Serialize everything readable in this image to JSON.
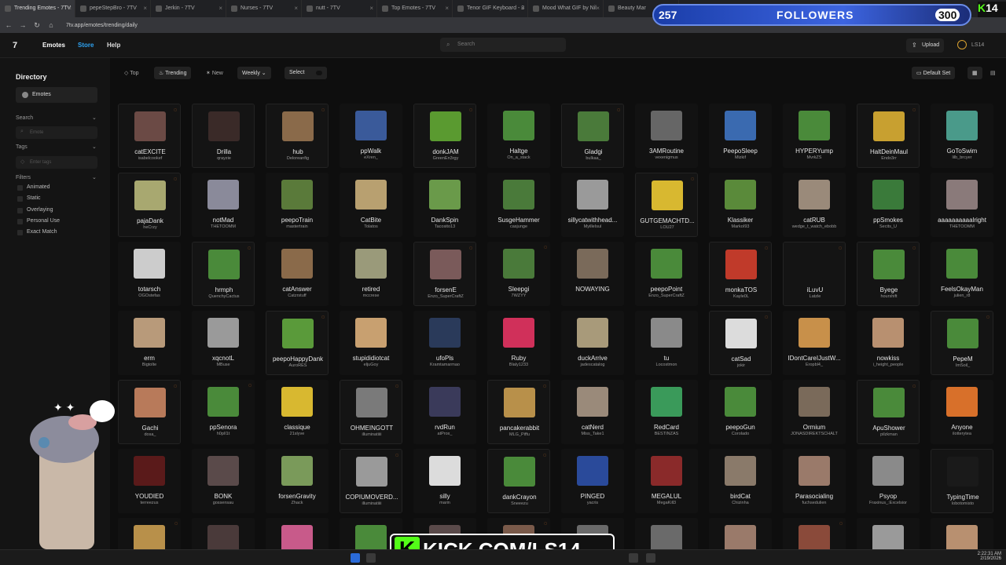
{
  "browser": {
    "tabs": [
      "Trending Emotes - 7TV",
      "pepeStepBro - 7TV",
      "Jerkin - 7TV",
      "Nurses - 7TV",
      "nutt - 7TV",
      "Top Emotes - 7TV",
      "Tenor GIF Keyboard - 3",
      "Mood What GIF by Nil",
      "Beauty Mar"
    ],
    "url": "7tv.app/emotes/trending/daily"
  },
  "app": {
    "nav": {
      "emotes": "Emotes",
      "store": "Store",
      "help": "Help"
    },
    "search_placeholder": "Search",
    "upload": "Upload",
    "user": "LS14"
  },
  "sidebar": {
    "title": "Directory",
    "emotes": "Emotes",
    "search_label": "Search",
    "emote_placeholder": "Emote",
    "tags_label": "Tags",
    "tags_placeholder": "Enter tags",
    "filters_label": "Filters",
    "filters": [
      "Animated",
      "Static",
      "Overlaying",
      "Personal Use",
      "Exact Match"
    ]
  },
  "toolbar": {
    "top": "Top",
    "trending": "Trending",
    "new": "New",
    "weekly": "Weekly",
    "select": "Select",
    "default_set": "Default Set"
  },
  "overlay": {
    "followers_current": "257",
    "followers_label": "FOLLOWERS",
    "followers_goal": "300",
    "kick_corner": "14",
    "kick_banner": "KICK.COM/LS14"
  },
  "clock": {
    "time": "2:22:31 AM",
    "date": "2/19/2026"
  },
  "emotes": [
    [
      {
        "n": "catEXCITE",
        "o": "isabelcookef",
        "c": "#6b4a45"
      },
      {
        "n": "Drilla",
        "o": "qrayzie",
        "c": "#3a2a28"
      },
      {
        "n": "hub",
        "o": "Deloreanfig",
        "c": "#8a6a4a"
      },
      {
        "n": "ppWalk",
        "o": "eXren_",
        "c": "#3a5a9a"
      },
      {
        "n": "donkJAM",
        "o": "GreenEn3rgy",
        "c": "#5a9a30"
      },
      {
        "n": "Haltge",
        "o": "On_a_stack",
        "c": "#4a8a3a"
      },
      {
        "n": "Gladgi",
        "o": "bulkaa_",
        "c": "#4a7a3a"
      },
      {
        "n": "3AMRoutine",
        "o": "vexenigmus",
        "c": "#666666"
      },
      {
        "n": "PeepoSleep",
        "o": "Mizkif",
        "c": "#3a6ab0"
      },
      {
        "n": "HYPERYump",
        "o": "MvrkZS",
        "c": "#4a8a3a"
      },
      {
        "n": "HaltDeinMaul",
        "o": "Endo3rr",
        "c": "#c8a030"
      },
      {
        "n": "GoToSwim",
        "o": "lilb_brcyer",
        "c": "#4a9a8a"
      }
    ],
    [
      {
        "n": "pajaDank",
        "o": "heCrzy",
        "c": "#a8a870"
      },
      {
        "n": "notMad",
        "o": "THETOOMM",
        "c": "#8a8a9a"
      },
      {
        "n": "peepoTrain",
        "o": "mastertrain",
        "c": "#5a7a3a"
      },
      {
        "n": "CatBite",
        "o": "Tolatos",
        "c": "#b8a070"
      },
      {
        "n": "DankSpin",
        "o": "Tacosito13",
        "c": "#6a9a4a"
      },
      {
        "n": "SusgeHammer",
        "o": "casjunge",
        "c": "#4a7a3a"
      },
      {
        "n": "sillycatwithhead...",
        "o": "MyilleIsul",
        "c": "#9a9a9a"
      },
      {
        "n": "GUTGEMACHTD...",
        "o": "LOU27",
        "c": "#d8b830"
      },
      {
        "n": "Klassiker",
        "o": "MarkoI93",
        "c": "#5a8a3a"
      },
      {
        "n": "catRUB",
        "o": "wedge_t_watch_ebobb",
        "c": "#9a8a7a"
      },
      {
        "n": "ppSmokes",
        "o": "Secits_U",
        "c": "#3a7a3a"
      },
      {
        "n": "aaaaaaaaaalright",
        "o": "THETOOMM",
        "c": "#8a7a7a"
      }
    ],
    [
      {
        "n": "totarsch",
        "o": "OGOstefas",
        "c": "#cccccc"
      },
      {
        "n": "hrmph",
        "o": "QuenchyCactus",
        "c": "#4a8a3a"
      },
      {
        "n": "catAnswer",
        "o": "Catzrstuff",
        "c": "#8a6a4a"
      },
      {
        "n": "retired",
        "o": "mccrese",
        "c": "#9a9a7a"
      },
      {
        "n": "forsenE",
        "o": "Enzo_SuperCraftZ",
        "c": "#7a5a5a"
      },
      {
        "n": "Sleepgi",
        "o": "7WZYY",
        "c": "#4a7a3a"
      },
      {
        "n": "NOWAYING",
        "o": "",
        "c": "#7a6a5a"
      },
      {
        "n": "peepoPoint",
        "o": "Enzo_SuperCraftZ",
        "c": "#4a8a3a"
      },
      {
        "n": "monkaTOS",
        "o": "Kayle0L",
        "c": "#c03a2a"
      },
      {
        "n": "iLuvU",
        "o": "Latzle",
        "c": "#141414"
      },
      {
        "n": "Byege",
        "o": "hourshift",
        "c": "#4a8a3a"
      },
      {
        "n": "FeelsOkayMan",
        "o": "julien_r8",
        "c": "#4a8a3a"
      }
    ],
    [
      {
        "n": "erm",
        "o": "Bigtolte",
        "c": "#b89a7a"
      },
      {
        "n": "xqcnotL",
        "o": "MBuse",
        "c": "#9a9a9a"
      },
      {
        "n": "peepoHappyDank",
        "o": "AuroRES",
        "c": "#5a9a3a"
      },
      {
        "n": "stupididiotcat",
        "o": "eljuGoy",
        "c": "#c8a070"
      },
      {
        "n": "ufoPls",
        "o": "Kramtamarmao",
        "c": "#2a3a5a"
      },
      {
        "n": "Ruby",
        "o": "Blaly1233",
        "c": "#d0305a"
      },
      {
        "n": "duckArrive",
        "o": "jadescatalog",
        "c": "#a89a7a"
      },
      {
        "n": "tu",
        "o": "Locostmon",
        "c": "#8a8a8a"
      },
      {
        "n": "catSad",
        "o": "jokir",
        "c": "#dcdcdc"
      },
      {
        "n": "IDontCareIJustW...",
        "o": "Eropbl4_",
        "c": "#c8904a"
      },
      {
        "n": "nowkiss",
        "o": "i_height_people",
        "c": "#b89070"
      },
      {
        "n": "PepeM",
        "o": "ImSoil_",
        "c": "#4a8a3a"
      }
    ],
    [
      {
        "n": "Gachi",
        "o": "dosa_",
        "c": "#b87a5a"
      },
      {
        "n": "ppSenora",
        "o": "h0pIl1t",
        "c": "#4a8a3a"
      },
      {
        "n": "classique",
        "o": "21slyve",
        "c": "#d8b830"
      },
      {
        "n": "OHMEINGOTT",
        "o": "illuminatiiii",
        "c": "#7a7a7a"
      },
      {
        "n": "rvdRun",
        "o": "atProx_",
        "c": "#3a3a5a"
      },
      {
        "n": "pancakerabbit",
        "o": "MLG_Piffu",
        "c": "#b8904a"
      },
      {
        "n": "catNerd",
        "o": "Miss_Take1",
        "c": "#9a8a7a"
      },
      {
        "n": "RedCard",
        "o": "BESTINZAS",
        "c": "#3a9a5a"
      },
      {
        "n": "peepoGun",
        "o": "Corolado",
        "c": "#4a8a3a"
      },
      {
        "n": "Ormium",
        "o": "JONASDIREKTSCHALT",
        "c": "#7a6a5a"
      },
      {
        "n": "ApuShower",
        "o": "pilzkman",
        "c": "#4a8a3a"
      },
      {
        "n": "Anyone",
        "o": "ilotterytea",
        "c": "#d8702a"
      }
    ],
    [
      {
        "n": "YOUDIED",
        "o": "terreezus",
        "c": "#5a1a1a"
      },
      {
        "n": "BONK",
        "o": "gossensau",
        "c": "#5a4a4a"
      },
      {
        "n": "forsenGravity",
        "o": "Zhack",
        "c": "#7a9a5a"
      },
      {
        "n": "COPIUMOVERD...",
        "o": "illuminatiiii",
        "c": "#9a9a9a"
      },
      {
        "n": "silly",
        "o": "marin",
        "c": "#dcdcdc"
      },
      {
        "n": "dankCrayon",
        "o": "Sneeezu",
        "c": "#4a8a3a"
      },
      {
        "n": "PINGED",
        "o": "yacris",
        "c": "#2a4a9a"
      },
      {
        "n": "MEGALUL",
        "o": "MegaKill3",
        "c": "#8a2a2a"
      },
      {
        "n": "birdCat",
        "o": "Chizinha",
        "c": "#8a7a6a"
      },
      {
        "n": "Parasocialing",
        "o": "fuchsedulien",
        "c": "#9a7a6a"
      },
      {
        "n": "Psyop",
        "o": "Fraxinus_:Excelsior",
        "c": "#8a8a8a"
      },
      {
        "n": "TypingTime",
        "o": "lobotomisto",
        "c": "#1a1a1a"
      }
    ],
    [
      {
        "n": "",
        "o": "",
        "c": "#b8904a"
      },
      {
        "n": "",
        "o": "",
        "c": "#4a3a3a"
      },
      {
        "n": "",
        "o": "",
        "c": "#c85a8a"
      },
      {
        "n": "",
        "o": "",
        "c": "#4a8a3a"
      },
      {
        "n": "",
        "o": "",
        "c": "#5a4a4a"
      },
      {
        "n": "",
        "o": "",
        "c": "#7a5a4a"
      },
      {
        "n": "",
        "o": "",
        "c": "#6a6a6a"
      },
      {
        "n": "",
        "o": "",
        "c": "#6a6a6a"
      },
      {
        "n": "",
        "o": "",
        "c": "#9a7a6a"
      },
      {
        "n": "",
        "o": "",
        "c": "#8a4a3a"
      },
      {
        "n": "",
        "o": "",
        "c": "#9a9a9a"
      },
      {
        "n": "",
        "o": "",
        "c": "#b89070"
      }
    ]
  ]
}
